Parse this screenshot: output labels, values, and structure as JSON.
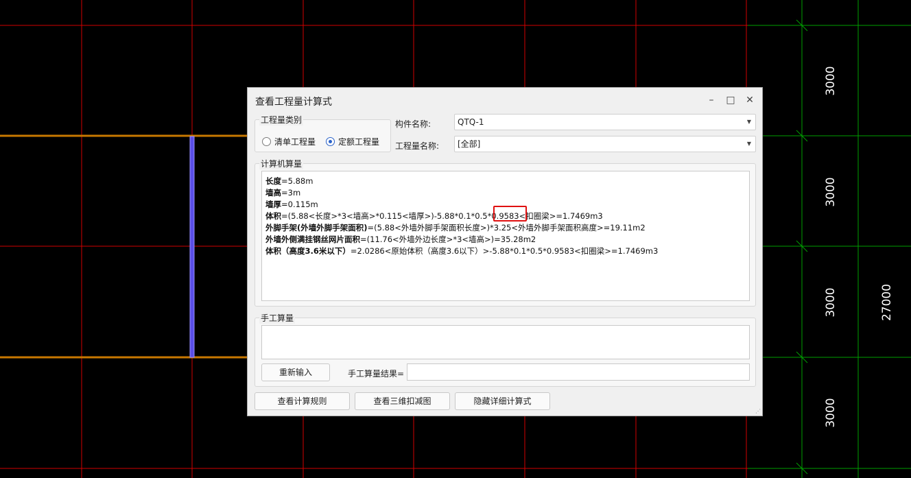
{
  "cad": {
    "dimensions": [
      "3000",
      "3000",
      "3000",
      "27000",
      "3000"
    ],
    "colors": {
      "grid_red": "#d20000",
      "grid_green": "#00a000",
      "beam_orange": "#c87800",
      "wall_blue": "#5a4ee8",
      "text_white": "#ffffff"
    }
  },
  "dialog": {
    "title": "查看工程量计算式",
    "controls": {
      "minimize": "–",
      "maximize": "□",
      "close": "✕"
    },
    "category_group": {
      "legend": "工程量类别",
      "options": [
        {
          "label": "清单工程量",
          "checked": false
        },
        {
          "label": "定额工程量",
          "checked": true
        }
      ]
    },
    "component_name": {
      "label": "构件名称:",
      "value": "QTQ-1"
    },
    "quantity_name": {
      "label": "工程量名称:",
      "value": "[全部]"
    },
    "computer_group": {
      "legend": "计算机算量",
      "lines": [
        {
          "term": "长度",
          "rest": "=5.88m"
        },
        {
          "term": "墙高",
          "rest": "=3m"
        },
        {
          "term": "墙厚",
          "rest": "=0.115m"
        },
        {
          "term": "体积",
          "rest": "=(5.88<长度>*3<墙高>*0.115<墙厚>)-5.88*0.1*0.5*0.9583<扣圈梁>=1.7469m3"
        },
        {
          "term": "外脚手架(外墙外脚手架面积)",
          "rest": "=(5.88<外墙外脚手架面积长度>)*3.25<外墙外脚手架面积高度>=19.11m2"
        },
        {
          "term": "外墙外侧满挂钢丝网片面积",
          "rest": "=(11.76<外墙外边长度>*3<墙高>)=35.28m2"
        },
        {
          "term": "体积（高度3.6米以下）",
          "rest": "=2.0286<原始体积（高度3.6以下）>-5.88*0.1*0.5*0.9583<扣圈梁>=1.7469m3"
        }
      ],
      "highlight_value": "0.9583"
    },
    "manual_group": {
      "legend": "手工算量",
      "reenter_button": "重新输入",
      "result_label": "手工算量结果=",
      "result_value": ""
    },
    "buttons": {
      "view_rules": "查看计算规则",
      "view_3d": "查看三维扣减图",
      "hide_details": "隐藏详细计算式"
    }
  }
}
